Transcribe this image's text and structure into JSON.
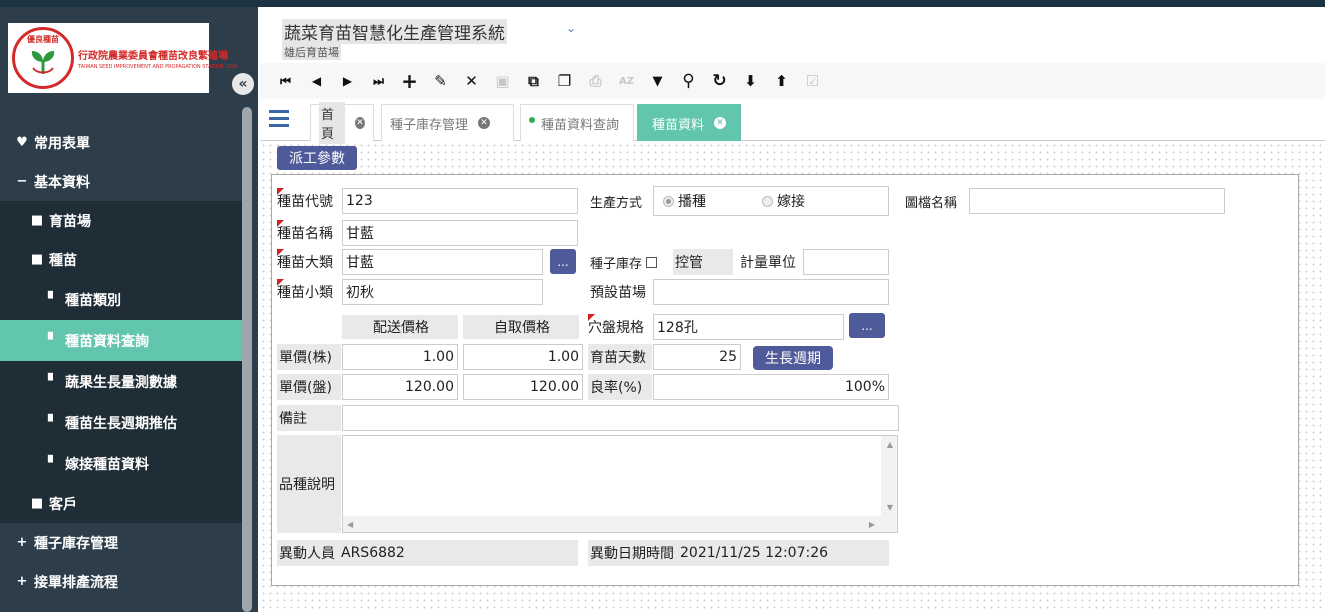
{
  "sidebar": {
    "logo": {
      "seal_text": "優良種苗",
      "org_name": "行政院農業委員會種苗改良繁殖場",
      "org_name_en": "TAIWAN SEED IMPROVEMENT AND PROPAGATION STATION, COA"
    },
    "collapse_glyph": "«",
    "items": [
      {
        "label": "常用表單",
        "icon": "heart-icon",
        "glyph": "♥"
      },
      {
        "label": "基本資料",
        "icon": "minus-icon",
        "glyph": "−"
      },
      {
        "label": "育苗場",
        "icon": "folder-icon",
        "glyph": "■"
      },
      {
        "label": "種苗",
        "icon": "folder-icon",
        "glyph": "■"
      },
      {
        "label": "種苗類別",
        "icon": "file-icon",
        "glyph": "▘"
      },
      {
        "label": "種苗資料查詢",
        "icon": "file-icon",
        "glyph": "▘"
      },
      {
        "label": "蔬果生長量測數據",
        "icon": "file-icon",
        "glyph": "▘"
      },
      {
        "label": "種苗生長週期推估",
        "icon": "file-icon",
        "glyph": "▘"
      },
      {
        "label": "嫁接種苗資料",
        "icon": "file-icon",
        "glyph": "▘"
      },
      {
        "label": "客戶",
        "icon": "folder-icon",
        "glyph": "■"
      },
      {
        "label": "種子庫存管理",
        "icon": "plus-icon",
        "glyph": "+"
      },
      {
        "label": "接單排產流程",
        "icon": "plus-icon",
        "glyph": "+"
      }
    ]
  },
  "header": {
    "title": "蔬菜育苗智慧化生產管理系統",
    "caret": "⌄",
    "subtitle": "雄后育苗場"
  },
  "toolbar": {
    "buttons": [
      {
        "name": "first-record-icon",
        "glyph": "⏮",
        "enabled": true
      },
      {
        "name": "prev-record-icon",
        "glyph": "◀",
        "enabled": true
      },
      {
        "name": "next-record-icon",
        "glyph": "▶",
        "enabled": true
      },
      {
        "name": "last-record-icon",
        "glyph": "⏭",
        "enabled": true
      },
      {
        "name": "add-icon",
        "glyph": "+",
        "enabled": true
      },
      {
        "name": "edit-icon",
        "glyph": "✎",
        "enabled": true
      },
      {
        "name": "delete-icon",
        "glyph": "✕",
        "enabled": true
      },
      {
        "name": "save-icon",
        "glyph": "▣",
        "enabled": false
      },
      {
        "name": "open-external-icon",
        "glyph": "⧉",
        "enabled": true
      },
      {
        "name": "copy-icon",
        "glyph": "❐",
        "enabled": true
      },
      {
        "name": "print-icon",
        "glyph": "⎙",
        "enabled": false
      },
      {
        "name": "sort-az-icon",
        "glyph": "AZ",
        "enabled": false
      },
      {
        "name": "filter-icon",
        "glyph": "▼",
        "enabled": true
      },
      {
        "name": "search-icon",
        "glyph": "⚲",
        "enabled": true
      },
      {
        "name": "refresh-icon",
        "glyph": "↻",
        "enabled": true
      },
      {
        "name": "download-icon",
        "glyph": "⬇",
        "enabled": true
      },
      {
        "name": "upload-icon",
        "glyph": "⬆",
        "enabled": true
      },
      {
        "name": "checklist-icon",
        "glyph": "☑",
        "enabled": false
      }
    ]
  },
  "tabs": [
    {
      "label": "首頁",
      "close": "✕"
    },
    {
      "label": "種子庫存管理",
      "close": "✕"
    },
    {
      "label": "種苗資料查詢",
      "close": ""
    },
    {
      "label": "種苗資料",
      "close": "✕"
    }
  ],
  "form": {
    "dispatch_button": "派工參數",
    "seedling_code": {
      "label": "種苗代號",
      "value": "123"
    },
    "seedling_name": {
      "label": "種苗名稱",
      "value": "甘藍"
    },
    "main_category": {
      "label": "種苗大類",
      "value": "甘藍"
    },
    "sub_category": {
      "label": "種苗小類",
      "value": "初秋"
    },
    "lookup_glyph": "...",
    "production_method": {
      "label": "生產方式",
      "options": [
        "播種",
        "嫁接"
      ],
      "selected": "播種"
    },
    "seed_stock": {
      "label": "種子庫存",
      "control_label": "控管"
    },
    "unit": {
      "label": "計量單位",
      "value": ""
    },
    "default_nursery": {
      "label": "預設苗場",
      "value": ""
    },
    "image_file": {
      "label": "圖檔名稱",
      "value": ""
    },
    "price_headers": {
      "delivery": "配送價格",
      "pickup": "自取價格"
    },
    "unit_price_plant": {
      "label": "單價(株)",
      "delivery": "1.00",
      "pickup": "1.00"
    },
    "unit_price_tray": {
      "label": "單價(盤)",
      "delivery": "120.00",
      "pickup": "120.00"
    },
    "tray_spec": {
      "label": "穴盤規格",
      "value": "128孔"
    },
    "nursery_days": {
      "label": "育苗天數",
      "value": "25"
    },
    "growth_cycle_button": "生長週期",
    "yield_rate": {
      "label": "良率(%)",
      "value": "100%"
    },
    "remarks": {
      "label": "備註",
      "value": ""
    },
    "variety_desc": {
      "label": "品種說明",
      "value": ""
    },
    "modified_by": {
      "label": "異動人員",
      "value": "ARS6882"
    },
    "modified_at": {
      "label": "異動日期時間",
      "value": "2021/11/25 12:07:26"
    }
  }
}
